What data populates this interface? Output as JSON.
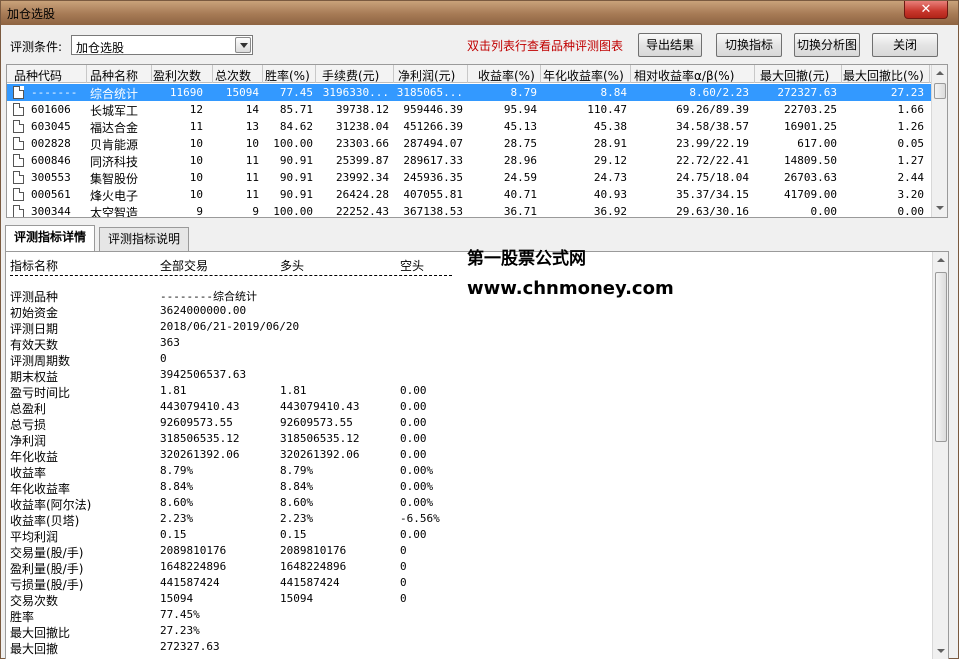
{
  "window": {
    "title": "加仓选股",
    "close_glyph": "✕"
  },
  "toolbar": {
    "condition_label": "评测条件:",
    "condition_value": "加仓选股",
    "hint": "双击列表行查看品种评测图表",
    "buttons": [
      "导出结果",
      "切换指标",
      "切换分析图",
      "关闭"
    ]
  },
  "grid": {
    "columns": [
      "品种代码",
      "品种名称",
      "盈利次数",
      "总次数",
      "胜率(%)",
      "手续费(元)",
      "净利润(元)",
      "收益率(%)",
      "年化收益率(%)",
      "相对收益率α/β(%)",
      "最大回撤(元)",
      "最大回撤比(%)"
    ],
    "rows": [
      [
        "-------",
        "综合统计",
        "11690",
        "15094",
        "77.45",
        "3196330...",
        "3185065...",
        "8.79",
        "8.84",
        "8.60/2.23",
        "272327.63",
        "27.23"
      ],
      [
        "601606",
        "长城军工",
        "12",
        "14",
        "85.71",
        "39738.12",
        "959446.39",
        "95.94",
        "110.47",
        "69.26/89.39",
        "22703.25",
        "1.66"
      ],
      [
        "603045",
        "福达合金",
        "11",
        "13",
        "84.62",
        "31238.04",
        "451266.39",
        "45.13",
        "45.38",
        "34.58/38.57",
        "16901.25",
        "1.26"
      ],
      [
        "002828",
        "贝肯能源",
        "10",
        "10",
        "100.00",
        "23303.66",
        "287494.07",
        "28.75",
        "28.91",
        "23.99/22.19",
        "617.00",
        "0.05"
      ],
      [
        "600846",
        "同济科技",
        "10",
        "11",
        "90.91",
        "25399.87",
        "289617.33",
        "28.96",
        "29.12",
        "22.72/22.41",
        "14809.50",
        "1.27"
      ],
      [
        "300553",
        "集智股份",
        "10",
        "11",
        "90.91",
        "23992.34",
        "245936.35",
        "24.59",
        "24.73",
        "24.75/18.04",
        "26703.63",
        "2.44"
      ],
      [
        "000561",
        "烽火电子",
        "10",
        "11",
        "90.91",
        "26424.28",
        "407055.81",
        "40.71",
        "40.93",
        "35.37/34.15",
        "41709.00",
        "3.20"
      ],
      [
        "300344",
        "太空智造",
        "9",
        "9",
        "100.00",
        "22252.43",
        "367138.53",
        "36.71",
        "36.92",
        "29.63/30.16",
        "0.00",
        "0.00"
      ]
    ]
  },
  "tabs": [
    "评测指标详情",
    "评测指标说明"
  ],
  "detail": {
    "headers": [
      "指标名称",
      "全部交易",
      "多头",
      "空头"
    ],
    "lines": [
      [
        "评测品种",
        "--------综合统计",
        "",
        ""
      ],
      [
        "初始资金",
        "3624000000.00",
        "",
        ""
      ],
      [
        "评测日期",
        "2018/06/21-2019/06/20",
        "",
        ""
      ],
      [
        "有效天数",
        "363",
        "",
        ""
      ],
      [
        "评测周期数",
        "0",
        "",
        ""
      ],
      [
        "期末权益",
        "3942506537.63",
        "",
        ""
      ],
      [
        "盈亏时间比",
        "1.81",
        "1.81",
        "0.00"
      ],
      [
        "总盈利",
        "443079410.43",
        "443079410.43",
        "0.00"
      ],
      [
        "总亏损",
        "92609573.55",
        "92609573.55",
        "0.00"
      ],
      [
        "净利润",
        "318506535.12",
        "318506535.12",
        "0.00"
      ],
      [
        "年化收益",
        "320261392.06",
        "320261392.06",
        "0.00"
      ],
      [
        "收益率",
        "8.79%",
        "8.79%",
        "0.00%"
      ],
      [
        "年化收益率",
        "8.84%",
        "8.84%",
        "0.00%"
      ],
      [
        "收益率(阿尔法)",
        "8.60%",
        "8.60%",
        "0.00%"
      ],
      [
        "收益率(贝塔)",
        "2.23%",
        "2.23%",
        "-6.56%"
      ],
      [
        "平均利润",
        "0.15",
        "0.15",
        "0.00"
      ],
      [
        "交易量(股/手)",
        "2089810176",
        "2089810176",
        "0"
      ],
      [
        "盈利量(股/手)",
        "1648224896",
        "1648224896",
        "0"
      ],
      [
        "亏损量(股/手)",
        "441587424",
        "441587424",
        "0"
      ],
      [
        "交易次数",
        "15094",
        "15094",
        "0"
      ],
      [
        "胜率",
        "77.45%",
        "",
        ""
      ],
      [
        "最大回撤比",
        "27.23%",
        "",
        ""
      ],
      [
        "最大回撤",
        "272327.63",
        "",
        ""
      ]
    ]
  },
  "watermark": {
    "line1": "第一股票公式网",
    "line2": "www.chnmoney.com"
  },
  "colors": {
    "selection": "#3399ff",
    "hint": "#c00000"
  }
}
